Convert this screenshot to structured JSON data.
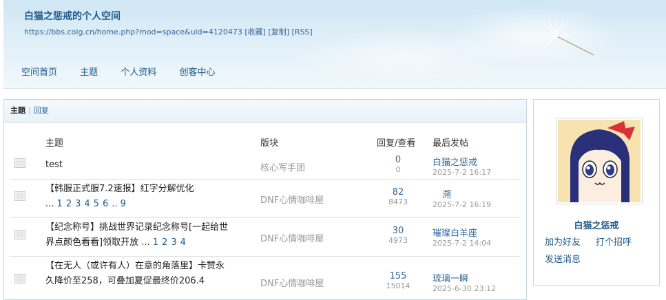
{
  "header": {
    "title": "白猫之惩戒的个人空间",
    "url": "https://bbs.colg.cn/home.php?mod=space&uid=4120473",
    "links": [
      "[收藏]",
      "[复制]",
      "[RSS]"
    ],
    "nav": [
      "空间首页",
      "主题",
      "个人资料",
      "创客中心"
    ]
  },
  "tabs": [
    "主题",
    "回复"
  ],
  "columns": {
    "subject": "主题",
    "forum": "版块",
    "replies": "回复/查看",
    "last": "最后发帖"
  },
  "threads": [
    {
      "line1": "test",
      "line2": "",
      "pages": [],
      "forum": "核心写手团",
      "replies": "0",
      "views": "0",
      "last_user": "白猫之惩戒",
      "last_time": "2025-7-2 16:17"
    },
    {
      "line1": "【韩服正式服7.2速报】红字分解优化",
      "line2": "...",
      "pages": [
        "1",
        "2",
        "3",
        "4",
        "5",
        "6",
        ".. 9"
      ],
      "forum": "DNF心情咖啡屋",
      "replies": "82",
      "views": "8473",
      "last_user": "溯",
      "last_time": "2025-7-2 16:19"
    },
    {
      "line1": "【纪念称号】挑战世界记录纪念称号[一起给世",
      "line2": "界点颜色看看]领取开放 ...",
      "pages": [
        "1",
        "2",
        "3",
        "4"
      ],
      "forum": "DNF心情咖啡屋",
      "replies": "30",
      "views": "4973",
      "last_user": "璀璨白羊座",
      "last_time": "2025-7-2 14:04"
    },
    {
      "line1": "【在无人（或许有人）在意的角落里】卡赞永",
      "line2": "久降价至258，可叠加夏促最终价206.4",
      "pages": [],
      "forum": "DNF心情咖啡屋",
      "replies": "155",
      "views": "15014",
      "last_user": "琉璃一瞬",
      "last_time": "2025-6-30 23:12"
    }
  ],
  "profile": {
    "name": "白猫之惩戒",
    "actions": [
      "加为好友",
      "打个招呼",
      "发送消息"
    ]
  },
  "colors": {
    "link": "#336699",
    "title": "#1f5b8a",
    "border": "#c5d7e3"
  }
}
